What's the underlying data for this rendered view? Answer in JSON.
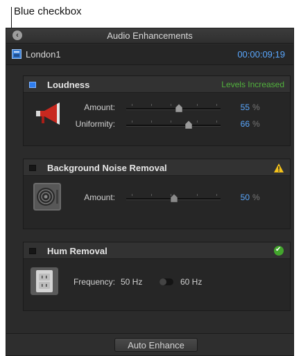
{
  "callout": {
    "text": "Blue checkbox"
  },
  "window": {
    "title": "Audio Enhancements"
  },
  "clip": {
    "name": "London1",
    "timecode": "00:00:09;19"
  },
  "loudness": {
    "title": "Loudness",
    "enabled": true,
    "status": "Levels Increased",
    "status_color": "#52b33d",
    "amount_label": "Amount:",
    "amount_value": "55",
    "amount_unit": "%",
    "uniformity_label": "Uniformity:",
    "uniformity_value": "66",
    "uniformity_unit": "%",
    "icon": "megaphone-icon"
  },
  "noise": {
    "title": "Background Noise Removal",
    "enabled": false,
    "icon": "fan-icon",
    "status_icon": "warning-icon",
    "amount_label": "Amount:",
    "amount_value": "50",
    "amount_unit": "%"
  },
  "hum": {
    "title": "Hum Removal",
    "enabled": false,
    "icon": "power-outlet-icon",
    "status_icon": "checkmark-icon",
    "frequency_label": "Frequency:",
    "option_a": "50 Hz",
    "option_b": "60 Hz"
  },
  "footer": {
    "auto_enhance_label": "Auto Enhance"
  },
  "colors": {
    "accent": "#5aa8ff",
    "panel": "#2b2b2b",
    "checkbox_on": "#2f7ef0"
  }
}
